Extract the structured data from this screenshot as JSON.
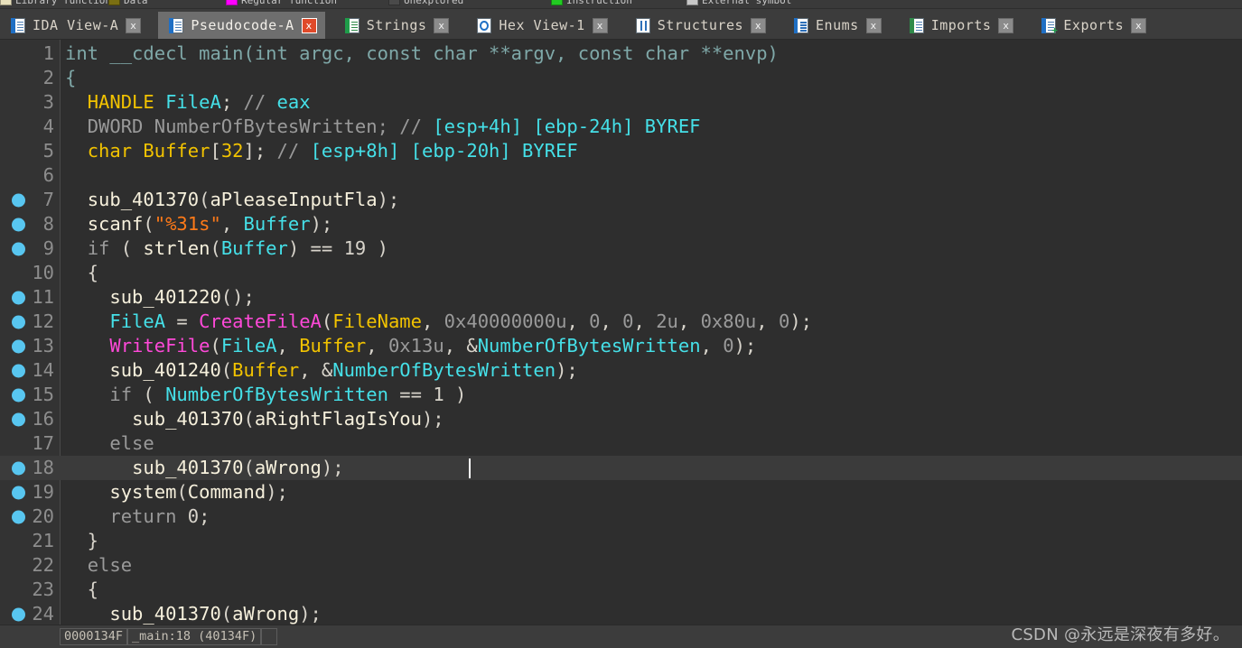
{
  "navband": {
    "legend": [
      {
        "label": "Library function",
        "color": "#e8e0bc"
      },
      {
        "label": "Data",
        "color": "#7a6f12"
      },
      {
        "label": "Regular function",
        "color": "#ff00ff"
      },
      {
        "label": "Unexplored",
        "color": "#4a4a4a"
      },
      {
        "label": "Instruction",
        "color": "#22cc22"
      },
      {
        "label": "External symbol",
        "color": "#c8c8c8"
      }
    ]
  },
  "tabs": [
    {
      "label": "IDA View-A",
      "icon": "document-blue-icon",
      "active": false,
      "close": "x",
      "close_style": "gray"
    },
    {
      "label": "Pseudocode-A",
      "icon": "document-blue-icon",
      "active": true,
      "close": "x",
      "close_style": "red"
    },
    {
      "label": "Strings",
      "icon": "strings-green-icon",
      "active": false,
      "close": "x",
      "close_style": "gray"
    },
    {
      "label": "Hex View-1",
      "icon": "hex-view-icon",
      "active": false,
      "close": "x",
      "close_style": "gray"
    },
    {
      "label": "Structures",
      "icon": "structures-icon",
      "active": false,
      "close": "x",
      "close_style": "gray"
    },
    {
      "label": "Enums",
      "icon": "enums-icon",
      "active": false,
      "close": "x",
      "close_style": "gray"
    },
    {
      "label": "Imports",
      "icon": "imports-icon",
      "active": false,
      "close": "x",
      "close_style": "gray"
    },
    {
      "label": "Exports",
      "icon": "exports-icon",
      "active": false,
      "close": "x",
      "close_style": "gray"
    }
  ],
  "editor": {
    "current_line": 18,
    "caret_line": 18,
    "lines": [
      {
        "n": 1,
        "bp": false,
        "hl": false,
        "tokens": [
          {
            "t": "int __cdecl main(int argc, const char **argv, const char **envp)",
            "c": "c-proto"
          }
        ]
      },
      {
        "n": 2,
        "bp": false,
        "hl": false,
        "tokens": [
          {
            "t": "{",
            "c": "c-proto"
          }
        ]
      },
      {
        "n": 3,
        "bp": false,
        "hl": false,
        "tokens": [
          {
            "t": "  ",
            "c": "c-plain"
          },
          {
            "t": "HANDLE",
            "c": "c-kw"
          },
          {
            "t": " ",
            "c": "c-plain"
          },
          {
            "t": "FileA",
            "c": "c-local"
          },
          {
            "t": "; ",
            "c": "c-plain"
          },
          {
            "t": "// ",
            "c": "c-cmt"
          },
          {
            "t": "eax",
            "c": "c-cmtcy"
          }
        ]
      },
      {
        "n": 4,
        "bp": false,
        "hl": false,
        "tokens": [
          {
            "t": "  ",
            "c": "c-plain"
          },
          {
            "t": "DWORD NumberOfBytesWritten; ",
            "c": "c-gray"
          },
          {
            "t": "// ",
            "c": "c-cmt"
          },
          {
            "t": "[esp+4h] [ebp-24h] BYREF",
            "c": "c-cmtcy"
          }
        ]
      },
      {
        "n": 5,
        "bp": false,
        "hl": false,
        "tokens": [
          {
            "t": "  ",
            "c": "c-plain"
          },
          {
            "t": "char",
            "c": "c-kw"
          },
          {
            "t": " ",
            "c": "c-plain"
          },
          {
            "t": "Buffer",
            "c": "c-kw"
          },
          {
            "t": "[",
            "c": "c-plain"
          },
          {
            "t": "32",
            "c": "c-kw"
          },
          {
            "t": "]; ",
            "c": "c-plain"
          },
          {
            "t": "// ",
            "c": "c-cmt"
          },
          {
            "t": "[esp+8h] [ebp-20h] BYREF",
            "c": "c-cmtcy"
          }
        ]
      },
      {
        "n": 6,
        "bp": false,
        "hl": false,
        "tokens": [
          {
            "t": "",
            "c": "c-plain"
          }
        ]
      },
      {
        "n": 7,
        "bp": true,
        "hl": false,
        "tokens": [
          {
            "t": "  ",
            "c": "c-plain"
          },
          {
            "t": "sub_401370",
            "c": "c-func"
          },
          {
            "t": "(",
            "c": "c-plain"
          },
          {
            "t": "aPleaseInputFla",
            "c": "c-func"
          },
          {
            "t": ");",
            "c": "c-plain"
          }
        ]
      },
      {
        "n": 8,
        "bp": true,
        "hl": false,
        "tokens": [
          {
            "t": "  ",
            "c": "c-plain"
          },
          {
            "t": "scanf",
            "c": "c-func"
          },
          {
            "t": "(",
            "c": "c-plain"
          },
          {
            "t": "\"%31s\"",
            "c": "c-str"
          },
          {
            "t": ", ",
            "c": "c-plain"
          },
          {
            "t": "Buffer",
            "c": "c-local"
          },
          {
            "t": ");",
            "c": "c-plain"
          }
        ]
      },
      {
        "n": 9,
        "bp": true,
        "hl": false,
        "tokens": [
          {
            "t": "  ",
            "c": "c-plain"
          },
          {
            "t": "if",
            "c": "c-gray"
          },
          {
            "t": " ( ",
            "c": "c-plain"
          },
          {
            "t": "strlen",
            "c": "c-func"
          },
          {
            "t": "(",
            "c": "c-plain"
          },
          {
            "t": "Buffer",
            "c": "c-local"
          },
          {
            "t": ") == ",
            "c": "c-plain"
          },
          {
            "t": "19",
            "c": "c-num"
          },
          {
            "t": " )",
            "c": "c-plain"
          }
        ]
      },
      {
        "n": 10,
        "bp": false,
        "hl": false,
        "tokens": [
          {
            "t": "  {",
            "c": "c-plain"
          }
        ]
      },
      {
        "n": 11,
        "bp": true,
        "hl": false,
        "tokens": [
          {
            "t": "    ",
            "c": "c-plain"
          },
          {
            "t": "sub_401220",
            "c": "c-func"
          },
          {
            "t": "();",
            "c": "c-plain"
          }
        ]
      },
      {
        "n": 12,
        "bp": true,
        "hl": false,
        "tokens": [
          {
            "t": "    ",
            "c": "c-plain"
          },
          {
            "t": "FileA",
            "c": "c-local"
          },
          {
            "t": " = ",
            "c": "c-plain"
          },
          {
            "t": "CreateFileA",
            "c": "c-api"
          },
          {
            "t": "(",
            "c": "c-plain"
          },
          {
            "t": "FileName",
            "c": "c-kw"
          },
          {
            "t": ", ",
            "c": "c-plain"
          },
          {
            "t": "0x40000000u",
            "c": "c-gray"
          },
          {
            "t": ", ",
            "c": "c-plain"
          },
          {
            "t": "0",
            "c": "c-gray"
          },
          {
            "t": ", ",
            "c": "c-plain"
          },
          {
            "t": "0",
            "c": "c-gray"
          },
          {
            "t": ", ",
            "c": "c-plain"
          },
          {
            "t": "2u",
            "c": "c-gray"
          },
          {
            "t": ", ",
            "c": "c-plain"
          },
          {
            "t": "0x80u",
            "c": "c-gray"
          },
          {
            "t": ", ",
            "c": "c-plain"
          },
          {
            "t": "0",
            "c": "c-gray"
          },
          {
            "t": ");",
            "c": "c-plain"
          }
        ]
      },
      {
        "n": 13,
        "bp": true,
        "hl": false,
        "tokens": [
          {
            "t": "    ",
            "c": "c-plain"
          },
          {
            "t": "WriteFile",
            "c": "c-api"
          },
          {
            "t": "(",
            "c": "c-plain"
          },
          {
            "t": "FileA",
            "c": "c-local"
          },
          {
            "t": ", ",
            "c": "c-plain"
          },
          {
            "t": "Buffer",
            "c": "c-kw"
          },
          {
            "t": ", ",
            "c": "c-plain"
          },
          {
            "t": "0x13u",
            "c": "c-gray"
          },
          {
            "t": ", &",
            "c": "c-plain"
          },
          {
            "t": "NumberOfBytesWritten",
            "c": "c-local"
          },
          {
            "t": ", ",
            "c": "c-plain"
          },
          {
            "t": "0",
            "c": "c-gray"
          },
          {
            "t": ");",
            "c": "c-plain"
          }
        ]
      },
      {
        "n": 14,
        "bp": true,
        "hl": false,
        "tokens": [
          {
            "t": "    ",
            "c": "c-plain"
          },
          {
            "t": "sub_401240",
            "c": "c-func"
          },
          {
            "t": "(",
            "c": "c-plain"
          },
          {
            "t": "Buffer",
            "c": "c-kw"
          },
          {
            "t": ", &",
            "c": "c-plain"
          },
          {
            "t": "NumberOfBytesWritten",
            "c": "c-local"
          },
          {
            "t": ");",
            "c": "c-plain"
          }
        ]
      },
      {
        "n": 15,
        "bp": true,
        "hl": false,
        "tokens": [
          {
            "t": "    ",
            "c": "c-plain"
          },
          {
            "t": "if",
            "c": "c-gray"
          },
          {
            "t": " ( ",
            "c": "c-plain"
          },
          {
            "t": "NumberOfBytesWritten",
            "c": "c-local"
          },
          {
            "t": " == ",
            "c": "c-plain"
          },
          {
            "t": "1",
            "c": "c-num"
          },
          {
            "t": " )",
            "c": "c-plain"
          }
        ]
      },
      {
        "n": 16,
        "bp": true,
        "hl": false,
        "tokens": [
          {
            "t": "      ",
            "c": "c-plain"
          },
          {
            "t": "sub_401370",
            "c": "c-func"
          },
          {
            "t": "(",
            "c": "c-plain"
          },
          {
            "t": "aRightFlagIsYou",
            "c": "c-func"
          },
          {
            "t": ");",
            "c": "c-plain"
          }
        ]
      },
      {
        "n": 17,
        "bp": false,
        "hl": false,
        "tokens": [
          {
            "t": "    ",
            "c": "c-plain"
          },
          {
            "t": "else",
            "c": "c-gray"
          }
        ]
      },
      {
        "n": 18,
        "bp": true,
        "hl": true,
        "tokens": [
          {
            "t": "      ",
            "c": "c-plain"
          },
          {
            "t": "sub_401370",
            "c": "c-func"
          },
          {
            "t": "(",
            "c": "c-plain"
          },
          {
            "t": "aWrong",
            "c": "c-func"
          },
          {
            "t": ");",
            "c": "c-plain"
          }
        ]
      },
      {
        "n": 19,
        "bp": true,
        "hl": false,
        "tokens": [
          {
            "t": "    ",
            "c": "c-plain"
          },
          {
            "t": "system",
            "c": "c-func"
          },
          {
            "t": "(",
            "c": "c-plain"
          },
          {
            "t": "Command",
            "c": "c-func"
          },
          {
            "t": ");",
            "c": "c-plain"
          }
        ]
      },
      {
        "n": 20,
        "bp": true,
        "hl": false,
        "tokens": [
          {
            "t": "    ",
            "c": "c-plain"
          },
          {
            "t": "return",
            "c": "c-gray"
          },
          {
            "t": " ",
            "c": "c-plain"
          },
          {
            "t": "0",
            "c": "c-num"
          },
          {
            "t": ";",
            "c": "c-plain"
          }
        ]
      },
      {
        "n": 21,
        "bp": false,
        "hl": false,
        "tokens": [
          {
            "t": "  }",
            "c": "c-plain"
          }
        ]
      },
      {
        "n": 22,
        "bp": false,
        "hl": false,
        "tokens": [
          {
            "t": "  ",
            "c": "c-plain"
          },
          {
            "t": "else",
            "c": "c-gray"
          }
        ]
      },
      {
        "n": 23,
        "bp": false,
        "hl": false,
        "tokens": [
          {
            "t": "  {",
            "c": "c-plain"
          }
        ]
      },
      {
        "n": 24,
        "bp": true,
        "hl": false,
        "tokens": [
          {
            "t": "    ",
            "c": "c-plain"
          },
          {
            "t": "sub_401370",
            "c": "c-func"
          },
          {
            "t": "(",
            "c": "c-plain"
          },
          {
            "t": "aWrong",
            "c": "c-func"
          },
          {
            "t": ");",
            "c": "c-plain"
          }
        ]
      }
    ]
  },
  "statusbar": {
    "offset": "0000134F",
    "location": "_main:18 (40134F)",
    "extra": ""
  },
  "watermark": "CSDN @永远是深夜有多好。",
  "colors": {
    "editor_bg": "#2e2e2e",
    "gutter_bg": "#333333",
    "highlight_line_bg": "#3b3b3b",
    "breakpoint": "#58c6f0",
    "keyword": "#f2c300",
    "local_var": "#45e0e8",
    "api_call": "#ff49d9",
    "string": "#ff7a18",
    "comment": "#9a9a9a",
    "active_tab_bg": "#6e6e6e",
    "close_red": "#e04a2a"
  }
}
